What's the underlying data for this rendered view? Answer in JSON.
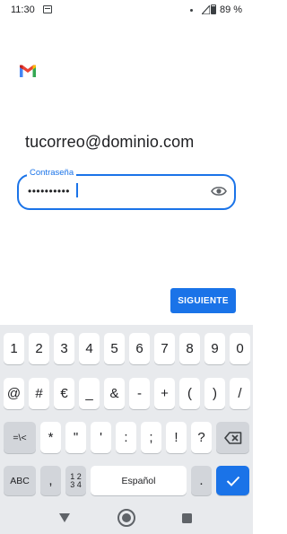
{
  "status": {
    "time": "11:30",
    "battery": "89 %"
  },
  "account": {
    "email": "tucorreo@dominio.com"
  },
  "password_field": {
    "label": "Contraseña",
    "value": "••••••••••"
  },
  "next_button": {
    "label": "SIGUIENTE"
  },
  "keyboard": {
    "row1": [
      "1",
      "2",
      "3",
      "4",
      "5",
      "6",
      "7",
      "8",
      "9",
      "0"
    ],
    "row2": [
      "@",
      "#",
      "€",
      "_",
      "&",
      "-",
      "+",
      "(",
      ")",
      "/"
    ],
    "row3": [
      "=\\<",
      "*",
      "\"",
      "'",
      ":",
      ";",
      "!",
      "?"
    ],
    "row4": {
      "abc": "ABC",
      "comma": ",",
      "num_top": "1 2",
      "num_bottom": "3 4",
      "space": "Español",
      "period": "."
    }
  },
  "colors": {
    "accent": "#1a73e8",
    "keyboard_bg": "#e8eaed",
    "function_key": "#d2d5da"
  }
}
